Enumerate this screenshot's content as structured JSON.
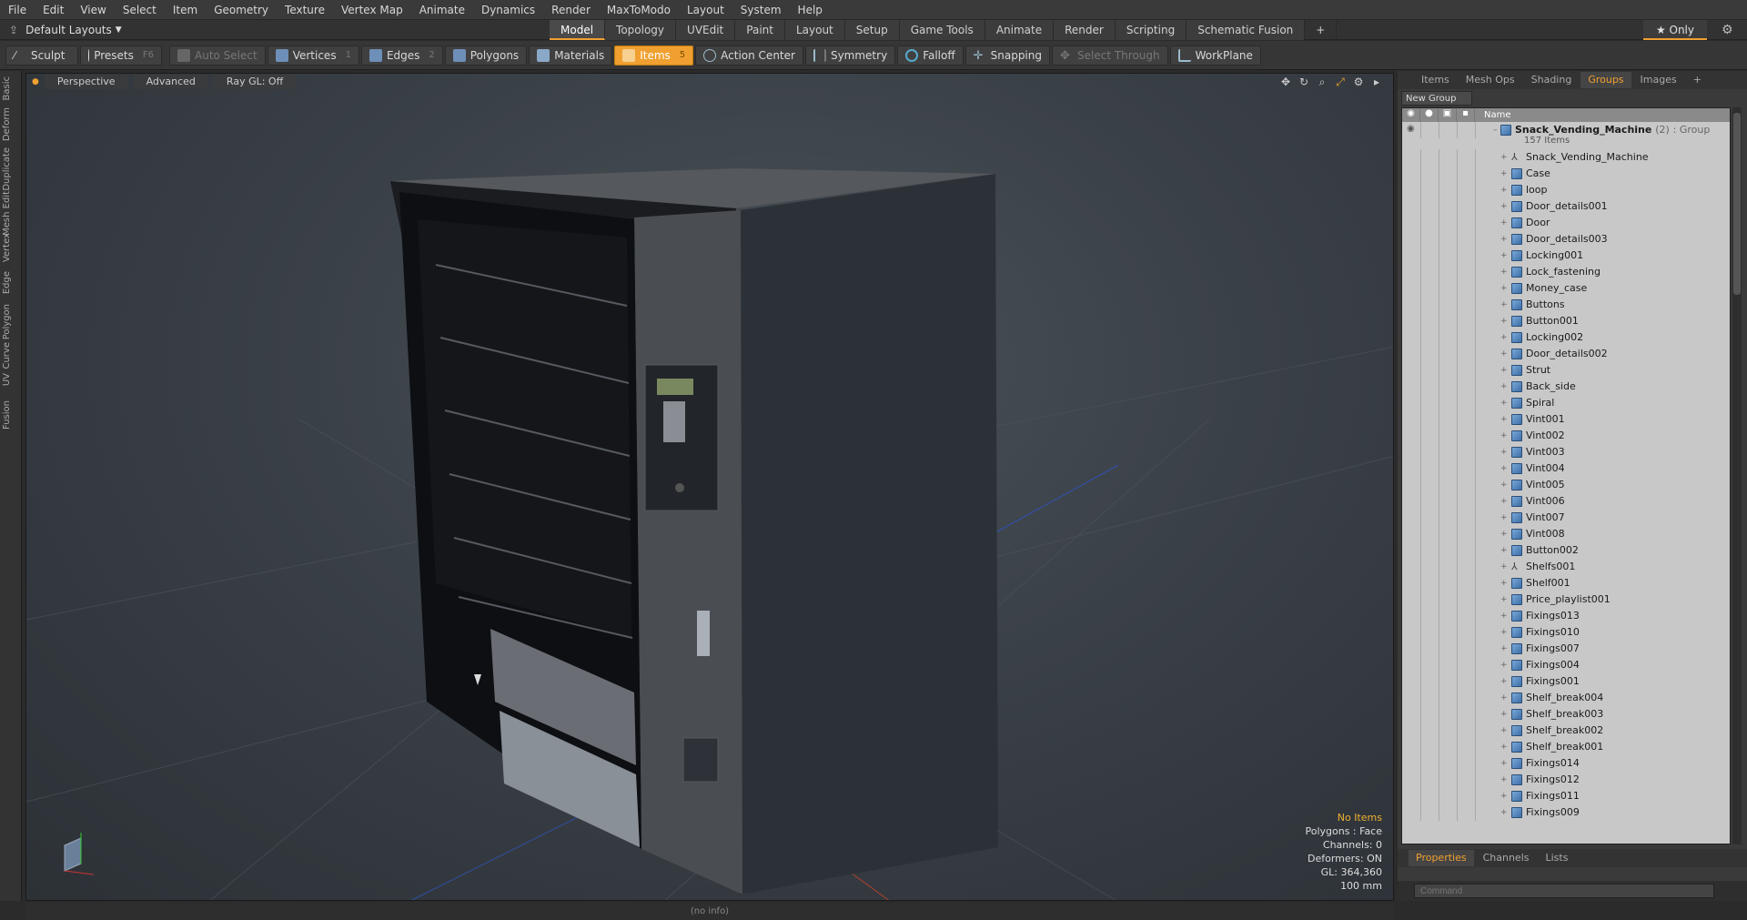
{
  "menu": [
    "File",
    "Edit",
    "View",
    "Select",
    "Item",
    "Geometry",
    "Texture",
    "Vertex Map",
    "Animate",
    "Dynamics",
    "Render",
    "MaxToModo",
    "Layout",
    "System",
    "Help"
  ],
  "layout_select": "Default Layouts",
  "layout_tabs": [
    {
      "label": "Model",
      "active": true
    },
    {
      "label": "Topology"
    },
    {
      "label": "UVEdit"
    },
    {
      "label": "Paint"
    },
    {
      "label": "Layout"
    },
    {
      "label": "Setup"
    },
    {
      "label": "Game Tools"
    },
    {
      "label": "Animate"
    },
    {
      "label": "Render"
    },
    {
      "label": "Scripting"
    },
    {
      "label": "Schematic Fusion"
    }
  ],
  "layout_add": "+",
  "only_label": "★ Only",
  "toolbar": {
    "sculpt": "Sculpt",
    "presets": "Presets",
    "presets_key": "F6",
    "auto_select": "Auto Select",
    "vertices": "Vertices",
    "vertices_key": "1",
    "edges": "Edges",
    "edges_key": "2",
    "polygons": "Polygons",
    "materials": "Materials",
    "items": "Items",
    "items_key": "5",
    "action_center": "Action Center",
    "symmetry": "Symmetry",
    "falloff": "Falloff",
    "snapping": "Snapping",
    "select_through": "Select Through",
    "workplane": "WorkPlane"
  },
  "left_tabs": [
    "Basic",
    "Deform",
    "Duplicate",
    "Mesh Edit",
    "Vertex",
    "Edge",
    "Polygon",
    "Curve",
    "UV",
    "Fusion"
  ],
  "viewport": {
    "view": "Perspective",
    "mode": "Advanced",
    "raygl": "Ray GL: Off",
    "info": {
      "no_items": "No Items",
      "polygons": "Polygons : Face",
      "channels": "Channels: 0",
      "deformers": "Deformers: ON",
      "gl": "GL: 364,360",
      "scale": "100 mm"
    }
  },
  "status": "(no info)",
  "right_tabs": [
    {
      "label": "Items"
    },
    {
      "label": "Mesh Ops"
    },
    {
      "label": "Shading"
    },
    {
      "label": "Groups",
      "active": true
    },
    {
      "label": "Images"
    }
  ],
  "new_group": "New Group",
  "tree_header": "Name",
  "group": {
    "name": "Snack_Vending_Machine",
    "count": "(2)",
    "tag": ": Group",
    "sub": "157 Items"
  },
  "items": [
    {
      "name": "Snack_Vending_Machine",
      "type": "locator"
    },
    {
      "name": "Case"
    },
    {
      "name": "loop"
    },
    {
      "name": "Door_details001"
    },
    {
      "name": "Door"
    },
    {
      "name": "Door_details003"
    },
    {
      "name": "Locking001"
    },
    {
      "name": "Lock_fastening"
    },
    {
      "name": "Money_case"
    },
    {
      "name": "Buttons"
    },
    {
      "name": "Button001"
    },
    {
      "name": "Locking002"
    },
    {
      "name": "Door_details002"
    },
    {
      "name": "Strut"
    },
    {
      "name": "Back_side"
    },
    {
      "name": "Spiral"
    },
    {
      "name": "Vint001"
    },
    {
      "name": "Vint002"
    },
    {
      "name": "Vint003"
    },
    {
      "name": "Vint004"
    },
    {
      "name": "Vint005"
    },
    {
      "name": "Vint006"
    },
    {
      "name": "Vint007"
    },
    {
      "name": "Vint008"
    },
    {
      "name": "Button002"
    },
    {
      "name": "Shelfs001",
      "type": "locator"
    },
    {
      "name": "Shelf001"
    },
    {
      "name": "Price_playlist001"
    },
    {
      "name": "Fixings013"
    },
    {
      "name": "Fixings010"
    },
    {
      "name": "Fixings007"
    },
    {
      "name": "Fixings004"
    },
    {
      "name": "Fixings001"
    },
    {
      "name": "Shelf_break004"
    },
    {
      "name": "Shelf_break003"
    },
    {
      "name": "Shelf_break002"
    },
    {
      "name": "Shelf_break001"
    },
    {
      "name": "Fixings014"
    },
    {
      "name": "Fixings012"
    },
    {
      "name": "Fixings011"
    },
    {
      "name": "Fixings009"
    }
  ],
  "bottom_tabs": [
    {
      "label": "Properties",
      "active": true
    },
    {
      "label": "Channels"
    },
    {
      "label": "Lists"
    }
  ],
  "command_placeholder": "Command",
  "colors": {
    "accent": "#f0a030",
    "tree_bg": "#c8c8c8",
    "mesh_icon": "#3b6fa8"
  }
}
